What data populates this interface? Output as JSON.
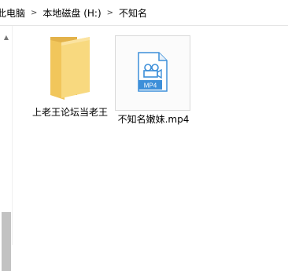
{
  "breadcrumb": {
    "items": [
      "此电脑",
      "本地磁盘 (H:)",
      "不知名"
    ],
    "separator": ">"
  },
  "files": [
    {
      "name": "上老王论坛当老王",
      "type": "folder",
      "icon": "folder-icon"
    },
    {
      "name": "不知名嫩妹.mp4",
      "type": "video",
      "icon": "mp4-file-icon",
      "badge": "MP4"
    }
  ],
  "colors": {
    "folder_back": "#e8b94a",
    "folder_front": "#f7d77d",
    "file_accent": "#3d8fd9"
  }
}
